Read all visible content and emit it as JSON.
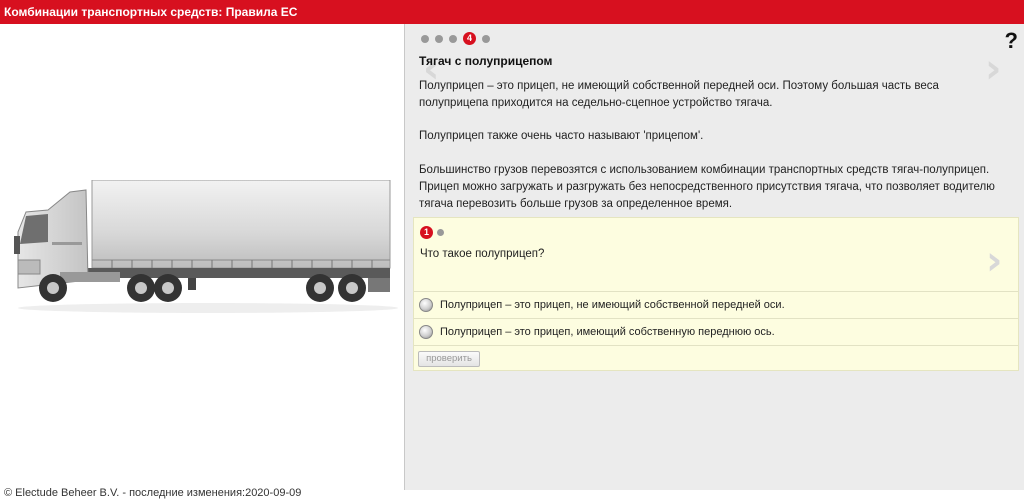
{
  "header": {
    "title": "Комбинации транспортных средств: Правила ЕС"
  },
  "footer": {
    "text": "© Electude Beheer B.V. - последние изменения:2020-09-09"
  },
  "pager": {
    "active_page": "4",
    "help_label": "?"
  },
  "content": {
    "title": "Тягач с полуприцепом",
    "paragraphs": [
      "Полуприцеп – это прицеп, не имеющий собственной передней оси. Поэтому большая часть веса полуприцепа приходится на седельно-сцепное устройство тягача.",
      "Полуприцеп также очень часто называют 'прицепом'.",
      "Большинство грузов перевозятся с использованием комбинации транспортных средств тягач-полуприцеп. Прицеп можно загружать и разгружать без непосредственного присутствия тягача, что позволяет водителю тягача перевозить больше грузов за определенное время."
    ]
  },
  "quiz": {
    "active_question": "1",
    "question": "Что такое полуприцеп?",
    "options": [
      "Полуприцеп – это прицеп, не имеющий собственной передней оси.",
      "Полуприцеп – это прицеп, имеющий собственную переднюю ось."
    ],
    "check_label": "проверить"
  },
  "icons": {
    "prev": "chevron-left-icon",
    "next": "chevron-right-icon",
    "help": "question-mark-icon"
  },
  "colors": {
    "brand_red": "#d7101f",
    "panel_bg": "#ececec",
    "quiz_bg": "#fdfde0"
  }
}
